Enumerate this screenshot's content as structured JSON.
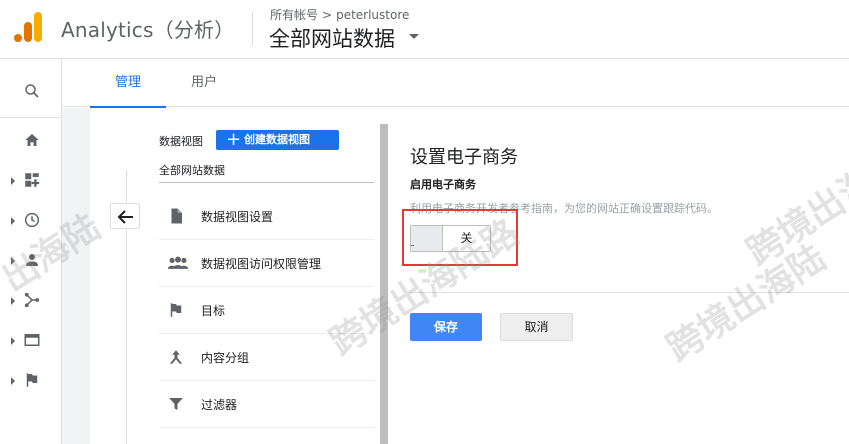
{
  "header": {
    "app_title": "Analytics（分析）",
    "breadcrumb": {
      "account": "所有帐号",
      "separator": ">",
      "property": "peterlustore"
    },
    "view_selector": "全部网站数据"
  },
  "rail": {
    "items": [
      {
        "icon": "search-icon"
      },
      {
        "icon": "home-icon"
      },
      {
        "icon": "customization-icon"
      },
      {
        "icon": "realtime-clock-icon"
      },
      {
        "icon": "audience-person-icon"
      },
      {
        "icon": "acquisition-icon"
      },
      {
        "icon": "behavior-icon"
      },
      {
        "icon": "conversions-flag-icon"
      }
    ]
  },
  "tabs": [
    {
      "label": "管理",
      "active": true
    },
    {
      "label": "用户",
      "active": false
    }
  ],
  "view_column": {
    "label": "数据视图",
    "create_button": "创建数据视图",
    "create_icon": "+",
    "selected_view": "全部网站数据",
    "menu": [
      {
        "icon": "document-icon",
        "label": "数据视图设置"
      },
      {
        "icon": "people-icon",
        "label": "数据视图访问权限管理"
      },
      {
        "icon": "flag-icon",
        "label": "目标"
      },
      {
        "icon": "content-grouping-icon",
        "label": "内容分组"
      },
      {
        "icon": "filter-icon",
        "label": "过滤器"
      }
    ]
  },
  "settings": {
    "title": "设置电子商务",
    "subtitle": "启用电子商务",
    "description": "利用电子商务开发者参考指南，为您的网站正确设置跟踪代码。",
    "toggle_state": "关",
    "save_button": "保存",
    "cancel_button": "取消"
  },
  "watermarks": [
    "出海陆",
    "跨境出海陆路",
    "跨境出海陆",
    "跨境出海陆"
  ],
  "colors": {
    "accent": "#1a73e8",
    "save_button": "#4285f4",
    "highlight": "#e53935",
    "logo_orange": "#f9ab00",
    "logo_dark_orange": "#e37400"
  }
}
